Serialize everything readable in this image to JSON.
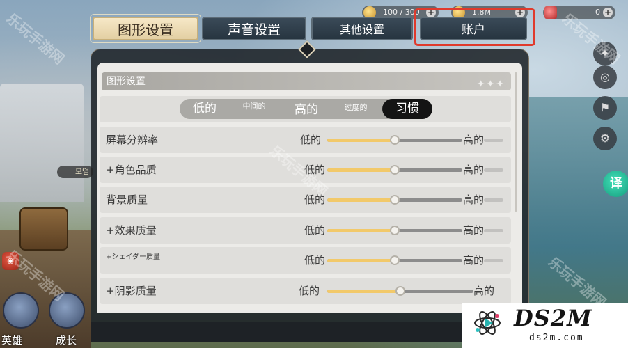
{
  "resources": {
    "stamina": "100 / 300",
    "gold": "1.8M",
    "gems": "0"
  },
  "tabs": [
    {
      "label": "图形设置",
      "active": true
    },
    {
      "label": "声音设置",
      "active": false
    },
    {
      "label": "其他设置",
      "active": false
    },
    {
      "label": "账户",
      "active": false
    }
  ],
  "graphics": {
    "section_title": "图形设置",
    "presets": {
      "low": "低的",
      "medium": "中间的",
      "high": "高的",
      "excessive": "过度的",
      "custom": "习惯",
      "selected": "习惯"
    },
    "settings": [
      {
        "label": "屏幕分辨率",
        "low": "低的",
        "high": "高的",
        "level": 0.5
      },
      {
        "label": "+角色品质",
        "low": "低的",
        "high": "高的",
        "level": 0.5
      },
      {
        "label": "背景质量",
        "low": "低的",
        "high": "高的",
        "level": 0.5
      },
      {
        "label": "+效果质量",
        "low": "低的",
        "high": "高的",
        "level": 0.5
      },
      {
        "label": "+シェイダー质量",
        "low": "低的",
        "high": "高的",
        "level": 0.5
      },
      {
        "label": "+阴影质量",
        "low": "低的",
        "high": "高的",
        "level": 0.5
      }
    ]
  },
  "hud": {
    "badge_text": "모엄",
    "hero_label": "英雄",
    "growth_label": "成长",
    "translate_label": "译"
  },
  "watermarks": {
    "site_text": "乐玩手游网",
    "logo_main": "DS2M",
    "logo_sub": "ds2m.com"
  },
  "colors": {
    "tab_active_bg": "#f6e8c7",
    "tab_inactive_bg": "#2f3e4a",
    "slider_fill": "#f2c96a",
    "highlight_border": "#e03a2c",
    "preset_selected_bg": "#141414"
  }
}
